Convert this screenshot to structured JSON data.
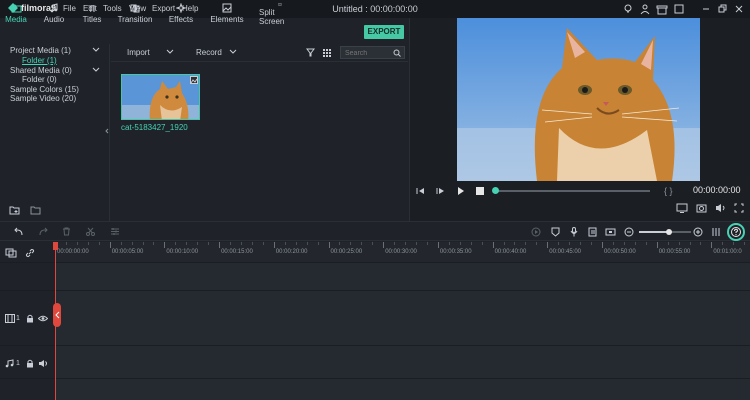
{
  "app": {
    "brand": "filmora9",
    "title": "Untitled : 00:00:00:00"
  },
  "menu": [
    "File",
    "Edit",
    "Tools",
    "View",
    "Export",
    "Help"
  ],
  "tabs": [
    {
      "label": "Media",
      "icon": "folder-icon",
      "active": true
    },
    {
      "label": "Audio",
      "icon": "music-note-icon"
    },
    {
      "label": "Titles",
      "icon": "titles-icon"
    },
    {
      "label": "Transition",
      "icon": "transition-icon"
    },
    {
      "label": "Effects",
      "icon": "effects-icon"
    },
    {
      "label": "Elements",
      "icon": "elements-icon"
    },
    {
      "label": "Split Screen",
      "icon": "split-screen-icon"
    }
  ],
  "export_label": "EXPORT",
  "tree": {
    "project_media": "Project Media (1)",
    "folder": "Folder (1)",
    "shared_media": "Shared Media (0)",
    "shared_folder": "Folder (0)",
    "sample_colors": "Sample Colors (15)",
    "sample_video": "Sample Video (20)"
  },
  "media_bar": {
    "import": "Import",
    "record": "Record",
    "search_placeholder": "Search"
  },
  "media_items": [
    {
      "name": "cat-5183427_1920"
    }
  ],
  "preview": {
    "timecode": "00:00:00:00",
    "brackets": "{ }"
  },
  "ruler": [
    "00:00:00:00",
    "00:00:05:00",
    "00:00:10:00",
    "00:00:15:00",
    "00:00:20:00",
    "00:00:25:00",
    "00:00:30:00",
    "00:00:35:00",
    "00:00:40:00",
    "00:00:45:00",
    "00:00:50:00",
    "00:00:55:00",
    "00:01:00:0"
  ],
  "tracks": [
    {
      "number": "1",
      "kind": "video"
    },
    {
      "number": "1",
      "kind": "audio"
    }
  ],
  "colors": {
    "accent": "#46d2b3",
    "playhead": "#e0473d"
  }
}
